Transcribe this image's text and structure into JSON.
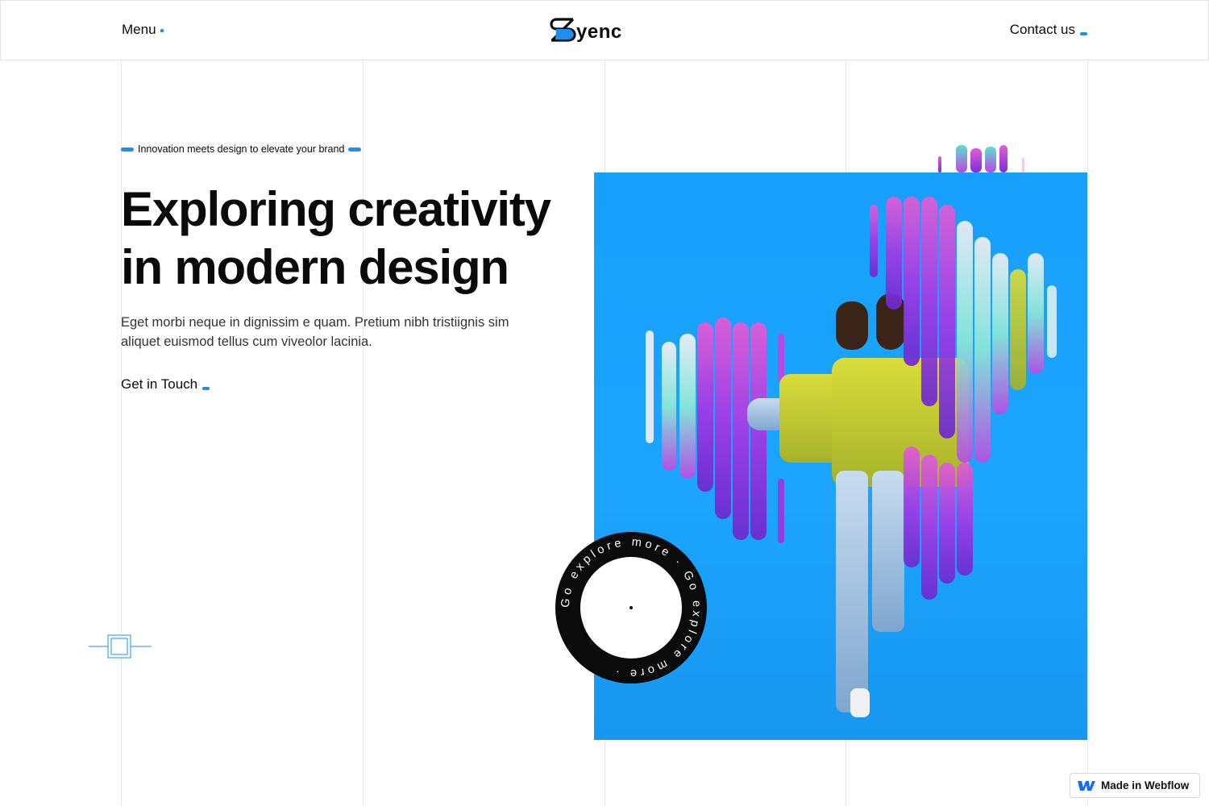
{
  "header": {
    "menu_label": "Menu",
    "logo_text": "yenc",
    "contact_label": "Contact us"
  },
  "hero": {
    "tagline": "Innovation meets design to elevate your brand",
    "headline_line1": "Exploring creativity",
    "headline_line2": "in modern design",
    "description": "Eget morbi neque in dignissim e quam. Pretium nibh tristiignis sim aliquet euismod tellus cum viveolor lacinia.",
    "cta_label": "Get in Touch"
  },
  "badge": {
    "circular_text": "Go explore more · Go explore more ·"
  },
  "webflow_badge": {
    "label": "Made in Webflow"
  },
  "colors": {
    "accent": "#1f8fef",
    "hero_background": "#1ca5ff",
    "text": "#0a0a0a",
    "badge_ring": "#0b0b0b"
  },
  "icons": {
    "logo": "sync-s-logo-icon",
    "badge_center": "dot-icon",
    "webflow": "webflow-w-icon"
  }
}
